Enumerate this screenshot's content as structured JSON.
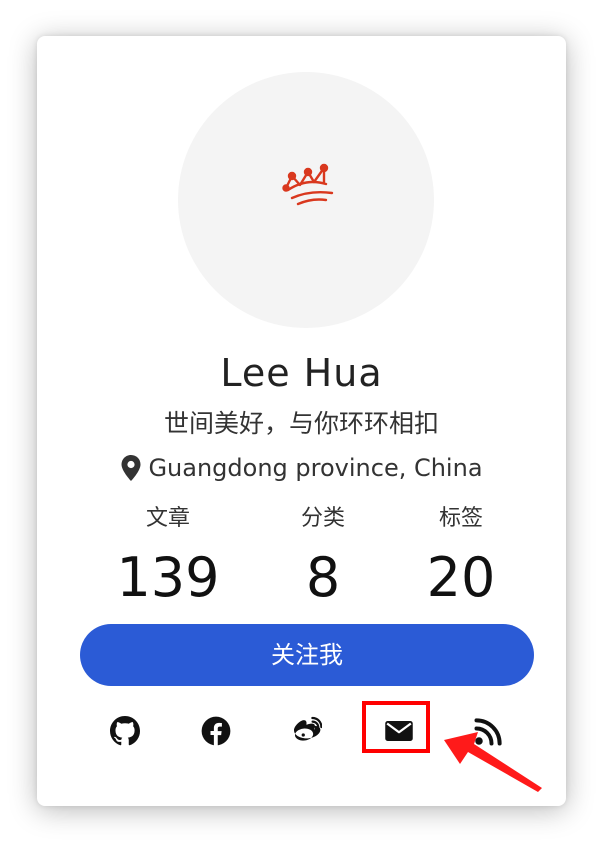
{
  "profile": {
    "name": "Lee Hua",
    "motto": "世间美好，与你环环相扣",
    "location": "Guangdong province, China"
  },
  "stats": [
    {
      "label": "文章",
      "count": "139"
    },
    {
      "label": "分类",
      "count": "8"
    },
    {
      "label": "标签",
      "count": "20"
    }
  ],
  "follow_button": {
    "label": "关注我"
  },
  "social_icons": [
    "github-icon",
    "facebook-icon",
    "weibo-icon",
    "email-icon",
    "rss-icon"
  ],
  "colors": {
    "accent": "#2b5bd6",
    "highlight": "#ff0000",
    "crown": "#d9381e",
    "avatar_bg": "#f4f4f4"
  }
}
